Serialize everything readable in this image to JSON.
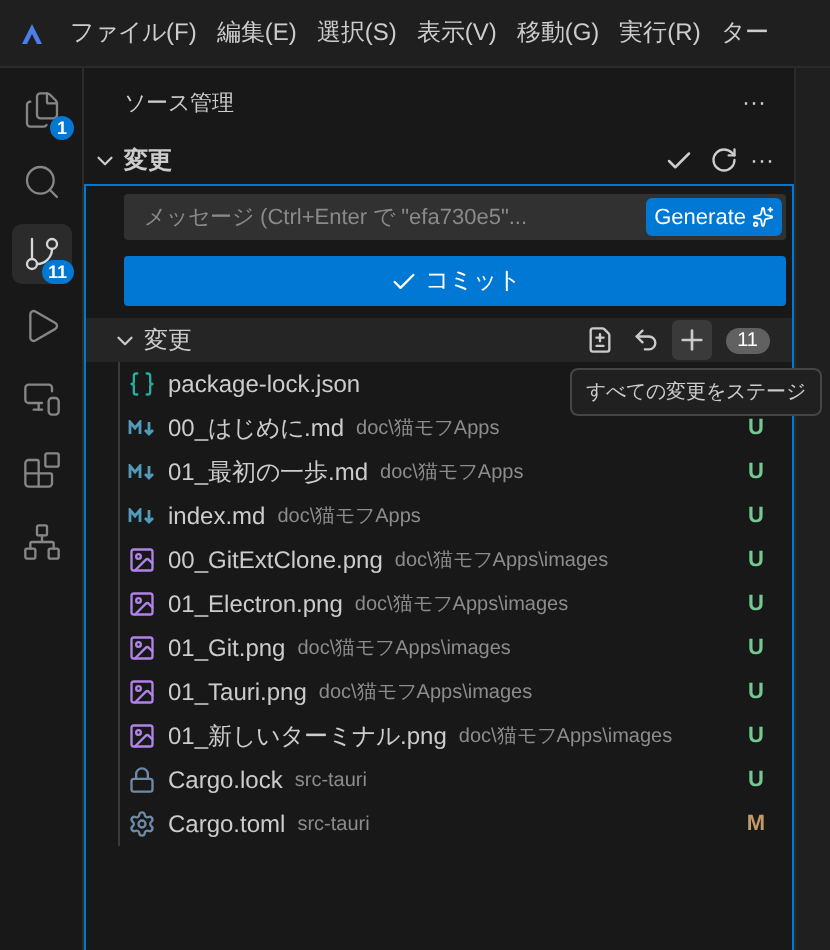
{
  "menu": [
    "ファイル(F)",
    "編集(E)",
    "選択(S)",
    "表示(V)",
    "移動(G)",
    "実行(R)",
    "ター"
  ],
  "activity": [
    {
      "kind": "files",
      "badge": "1",
      "selected": false
    },
    {
      "kind": "search",
      "selected": false
    },
    {
      "kind": "source-control",
      "badge": "11",
      "selected": true
    },
    {
      "kind": "run",
      "selected": false
    },
    {
      "kind": "remote",
      "selected": false
    },
    {
      "kind": "extensions",
      "selected": false
    },
    {
      "kind": "nodes",
      "selected": false
    }
  ],
  "panel": {
    "title": "ソース管理",
    "more": "···"
  },
  "repo": {
    "label": "変更",
    "expanded": true,
    "more": "···"
  },
  "message": {
    "placeholder": "メッセージ (Ctrl+Enter で \"efa730e5\"...",
    "generate": "Generate"
  },
  "commit": {
    "label": "コミット"
  },
  "changes": {
    "label": "変更",
    "expanded": true,
    "count": "11",
    "tooltip": "すべての変更をステージ",
    "files": [
      {
        "kind": "json",
        "name": "package-lock.json"
      },
      {
        "kind": "markdown",
        "name": "00_はじめに.md",
        "path": "doc\\猫モフApps",
        "status": "U",
        "color": "#73c991"
      },
      {
        "kind": "markdown",
        "name": "01_最初の一歩.md",
        "path": "doc\\猫モフApps",
        "status": "U",
        "color": "#73c991"
      },
      {
        "kind": "markdown",
        "name": "index.md",
        "path": "doc\\猫モフApps",
        "status": "U",
        "color": "#73c991"
      },
      {
        "kind": "image",
        "name": "00_GitExtClone.png",
        "path": "doc\\猫モフApps\\images",
        "status": "U",
        "color": "#73c991"
      },
      {
        "kind": "image",
        "name": "01_Electron.png",
        "path": "doc\\猫モフApps\\images",
        "status": "U",
        "color": "#73c991"
      },
      {
        "kind": "image",
        "name": "01_Git.png",
        "path": "doc\\猫モフApps\\images",
        "status": "U",
        "color": "#73c991"
      },
      {
        "kind": "image",
        "name": "01_Tauri.png",
        "path": "doc\\猫モフApps\\images",
        "status": "U",
        "color": "#73c991"
      },
      {
        "kind": "image",
        "name": "01_新しいターミナル.png",
        "path": "doc\\猫モフApps\\images",
        "status": "U",
        "color": "#73c991"
      },
      {
        "kind": "lock",
        "name": "Cargo.lock",
        "path": "src-tauri",
        "status": "U",
        "color": "#73c991"
      },
      {
        "kind": "gear",
        "name": "Cargo.toml",
        "path": "src-tauri",
        "status": "M",
        "color": "#c09a6b"
      }
    ]
  }
}
